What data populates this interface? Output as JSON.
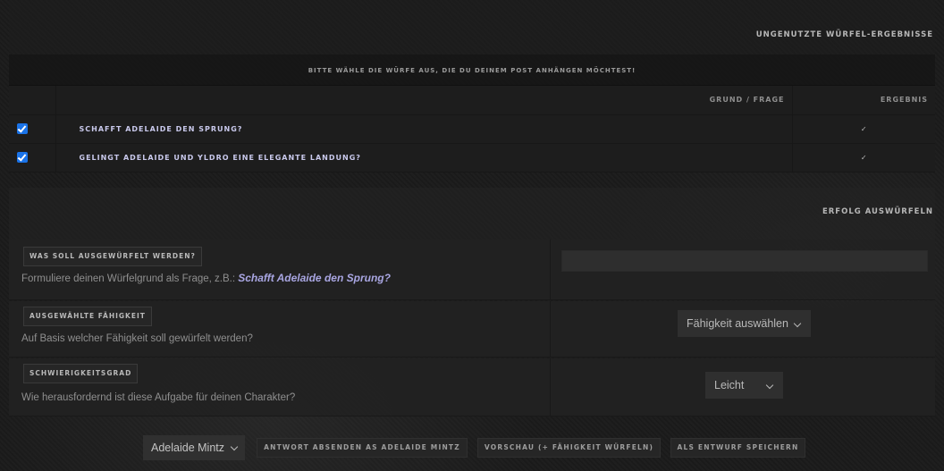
{
  "unused_dice": {
    "title": "UNGENUTZTE WÜRFEL-ERGEBNISSE",
    "instruction": "BITTE WÄHLE DIE WÜRFE AUS, DIE DU DEINEM POST ANHÄNGEN MÖCHTEST!",
    "columns": {
      "reason": "GRUND / FRAGE",
      "result": "ERGEBNIS"
    },
    "rows": [
      {
        "checked": true,
        "reason": "SCHAFFT ADELAIDE DEN SPRUNG?",
        "result": "✓"
      },
      {
        "checked": true,
        "reason": "GELINGT ADELAIDE UND YLDRO EINE ELEGANTE LANDUNG?",
        "result": "✓"
      }
    ]
  },
  "dice_roll": {
    "title": "ERFOLG AUSWÜRFELN",
    "question": {
      "label": "WAS SOLL AUSGEWÜRFELT WERDEN?",
      "description": "Formuliere deinen Würfelgrund als Frage, z.B.:",
      "example": "Schafft Adelaide den Sprung?",
      "value": ""
    },
    "ability": {
      "label": "AUSGEWÄHLTE FÄHIGKEIT",
      "description": "Auf Basis welcher Fähigkeit soll gewürfelt werden?",
      "selected": "Fähigkeit auswählen"
    },
    "difficulty": {
      "label": "SCHWIERIGKEITSGRAD",
      "description": "Wie herausfordernd ist diese Aufgabe für deinen Charakter?",
      "selected": "Leicht"
    }
  },
  "toolbar": {
    "character": "Adelaide Mintz",
    "submit_label": "ANTWORT ABSENDEN AS ADELAIDE MINTZ",
    "preview_label": "VORSCHAU (+ FÄHIGKEIT WÜRFELN)",
    "draft_label": "ALS ENTWURF SPEICHERN"
  },
  "colors": {
    "accent_text": "#a9a6e2",
    "checkbox": "#1a73e8",
    "background": "#1b1b1b"
  }
}
